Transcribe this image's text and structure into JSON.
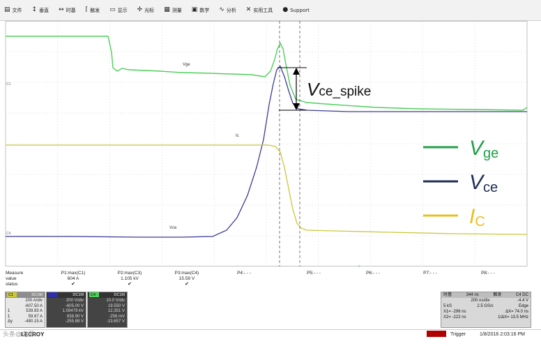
{
  "menubar": {
    "items": [
      {
        "icon": "file-icon",
        "glyph": "▤",
        "label": "文件"
      },
      {
        "icon": "vertical-icon",
        "glyph": "↕",
        "label": "垂直"
      },
      {
        "icon": "timebase-icon",
        "glyph": "↔",
        "label": "时基"
      },
      {
        "icon": "trigger-icon",
        "glyph": "⌈",
        "label": "触发"
      },
      {
        "icon": "display-icon",
        "glyph": "▭",
        "label": "显示"
      },
      {
        "icon": "cursor-icon",
        "glyph": "✢",
        "label": "光标"
      },
      {
        "icon": "measure-icon",
        "glyph": "▦",
        "label": "测量"
      },
      {
        "icon": "math-icon",
        "glyph": "▣",
        "label": "数学"
      },
      {
        "icon": "analysis-icon",
        "glyph": "∿",
        "label": "分析"
      },
      {
        "icon": "tools-icon",
        "glyph": "✕",
        "label": "实用工具"
      },
      {
        "icon": "support-icon",
        "glyph": "●",
        "label": "Support"
      }
    ]
  },
  "scope": {
    "trace_labels": {
      "vge": "Vge",
      "ic": "Ic",
      "vce": "Vce"
    },
    "channel_markers": {
      "c1": "C1",
      "c4": "C4"
    },
    "spike_annotation": {
      "main": "V",
      "sub": "ce_spike"
    },
    "legend": [
      {
        "main": "V",
        "sub": "ge",
        "color": "#22a04a"
      },
      {
        "main": "V",
        "sub": "ce",
        "color": "#1e2d55"
      },
      {
        "main": "I",
        "sub": "C",
        "color": "#e8c020"
      }
    ],
    "colors": {
      "vge": "#4fcf5a",
      "vce": "#3c3a96",
      "ic": "#c8c83a",
      "grid": "#b8b8b8"
    }
  },
  "measure": {
    "row_labels": [
      "Measure",
      "value",
      "status"
    ],
    "params": [
      {
        "name": "P1:max(C1)",
        "value": "604 A",
        "status": "✔"
      },
      {
        "name": "P2:max(C3)",
        "value": "1.105 kV",
        "status": "✔"
      },
      {
        "name": "P3:max(C4)",
        "value": "15.59 V",
        "status": "✔"
      },
      {
        "name": "P4:- - -",
        "value": "",
        "status": ""
      },
      {
        "name": "P5:- - -",
        "value": "",
        "status": ""
      },
      {
        "name": "P6:- - -",
        "value": "",
        "status": ""
      },
      {
        "name": "P7:- - -",
        "value": "",
        "status": ""
      },
      {
        "name": "P8:- - -",
        "value": "",
        "status": ""
      }
    ]
  },
  "channels": [
    {
      "name": "C1",
      "coupling": "DC1M",
      "color": "#c8c83a",
      "light": true,
      "rows": [
        "200 A/div",
        "-607.50 A",
        "539.83 A",
        "59.67 A",
        "-480.15 A"
      ],
      "lbls": [
        "",
        "",
        "1",
        "1",
        "Δy"
      ]
    },
    {
      "name": "",
      "coupling": "DC1M",
      "color": "#2f2fa8",
      "light": false,
      "rows": [
        "200 V/div",
        "-605.00 V",
        "1.09479 kV",
        "838.90 V",
        "-255.88 V"
      ],
      "lbls": [
        "",
        "",
        "",
        "",
        ""
      ]
    },
    {
      "name": "C4",
      "coupling": "DC1M",
      "color": "#4fcf5a",
      "light": false,
      "rows": [
        "10.0 V/div",
        "19.550 V",
        "12.351 V",
        "-256 mV",
        "-13.657 V"
      ],
      "lbls": [
        "",
        "",
        "",
        "",
        ""
      ]
    }
  ],
  "timebase": {
    "title": "时基",
    "trig_label": "触发",
    "delay": "344 ns",
    "trig_ch": "C4 DC",
    "tdiv": "200 ns/div",
    "trig_lvl": "-4.4 V",
    "samples": "5 kS",
    "srate": "2.5 GS/s",
    "mode": "Edge",
    "x1": "X1=",
    "x1v": "-296 ns",
    "dx": "ΔX=",
    "dxv": "74.0 ns",
    "x2": "X2=",
    "x2v": "-222 ns",
    "idx": "1/ΔX=",
    "idxv": "13.5 MHz"
  },
  "statusbar": {
    "brand": "LECROY",
    "trigger": "Trigger",
    "datetime": "1/8/2016 2:03:16 PM"
  },
  "watermark": "头条@电源"
}
